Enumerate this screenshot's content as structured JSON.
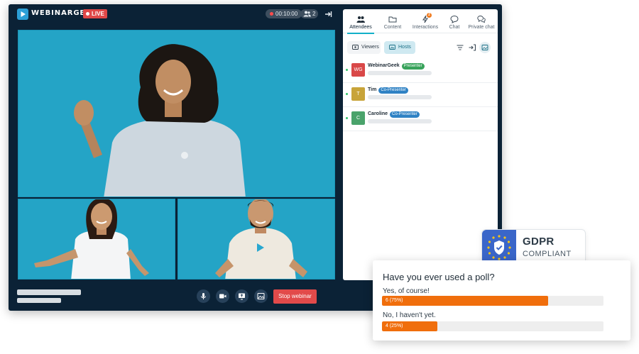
{
  "header": {
    "brand": "WEBINARGEEK",
    "live_label": "LIVE",
    "timer": "00:10:00",
    "attendee_count": "2"
  },
  "controls": {
    "stop_label": "Stop webinar"
  },
  "panel": {
    "tabs": [
      {
        "label": "Attendees",
        "icon": "people-icon",
        "active": true
      },
      {
        "label": "Content",
        "icon": "folder-icon"
      },
      {
        "label": "Interactions",
        "icon": "lightning-icon",
        "badge": "2"
      },
      {
        "label": "Chat",
        "icon": "chat-bubble-icon"
      },
      {
        "label": "Private chat",
        "icon": "private-chat-icon"
      }
    ],
    "segments": {
      "viewers": "Viewers",
      "hosts": "Hosts",
      "selected": "Hosts"
    },
    "hosts": [
      {
        "initials": "WG",
        "name": "WebinarGeek",
        "role": "Presenter",
        "avatar_color": "#d94848",
        "role_color": "#38a35b"
      },
      {
        "initials": "T",
        "name": "Tim",
        "role": "Co-Presenter",
        "avatar_color": "#c8a43a",
        "role_color": "#2f82c4"
      },
      {
        "initials": "C",
        "name": "Caroline",
        "role": "Co-Presenter",
        "avatar_color": "#4aa36b",
        "role_color": "#2f82c4"
      }
    ]
  },
  "gdpr": {
    "title": "GDPR",
    "subtitle": "COMPLIANT"
  },
  "poll": {
    "question": "Have you ever used a poll?",
    "options": [
      {
        "label": "Yes, of course!",
        "votes": 6,
        "percent": 75,
        "result_text": "6 (75%)"
      },
      {
        "label": "No, I haven't yet.",
        "votes": 4,
        "percent": 25,
        "result_text": "4 (25%)"
      }
    ],
    "bar_color": "#f06e0c"
  }
}
